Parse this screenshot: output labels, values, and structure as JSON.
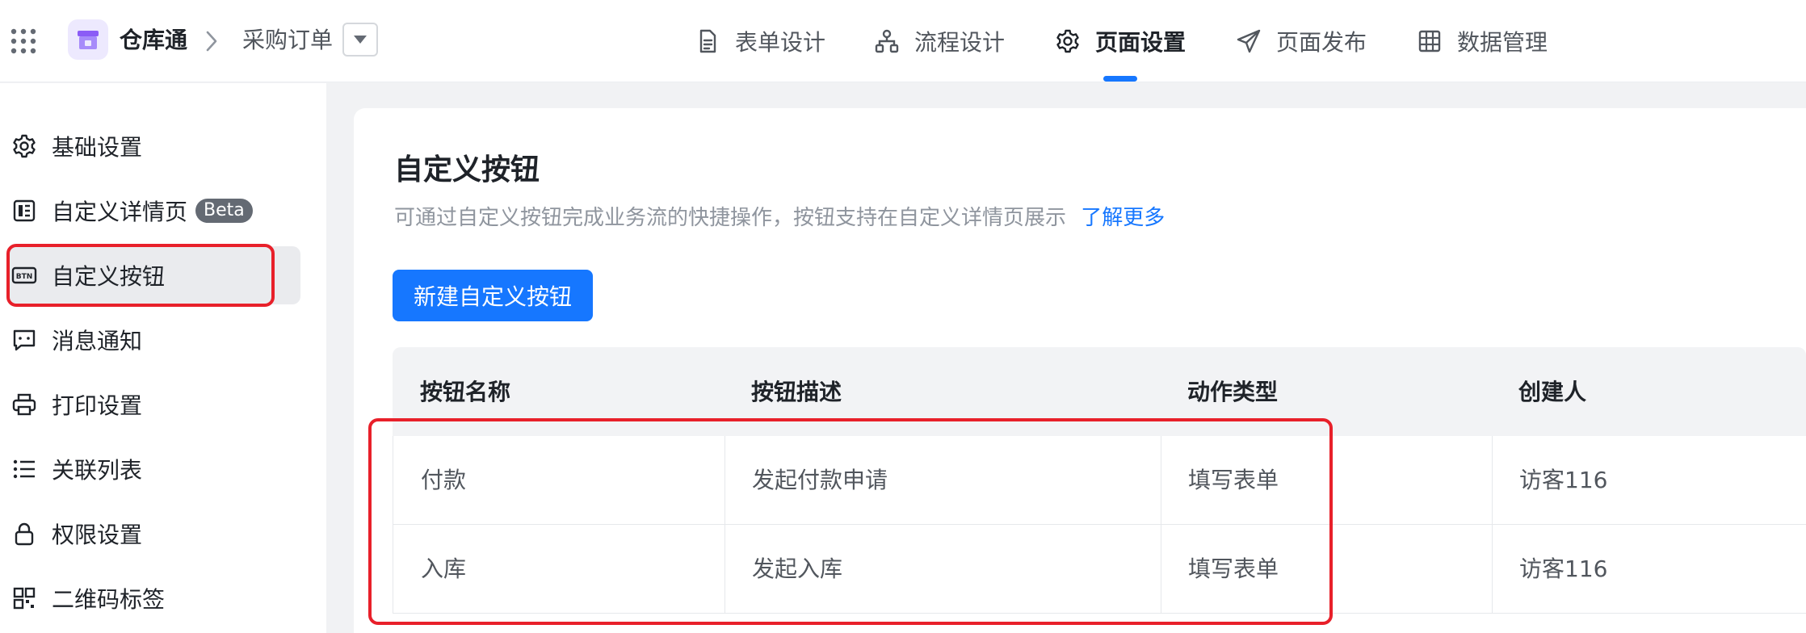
{
  "header": {
    "app_name": "仓库通",
    "current_page": "采购订单",
    "tabs": [
      {
        "label": "表单设计",
        "icon": "document-icon"
      },
      {
        "label": "流程设计",
        "icon": "flow-icon"
      },
      {
        "label": "页面设置",
        "icon": "gear-icon",
        "active": true
      },
      {
        "label": "页面发布",
        "icon": "send-icon"
      },
      {
        "label": "数据管理",
        "icon": "grid-icon"
      }
    ]
  },
  "sidebar": {
    "items": [
      {
        "label": "基础设置",
        "icon": "gear-icon"
      },
      {
        "label": "自定义详情页",
        "icon": "detail-page-icon",
        "badge": "Beta"
      },
      {
        "label": "自定义按钮",
        "icon": "btn-icon",
        "active": true
      },
      {
        "label": "消息通知",
        "icon": "message-icon"
      },
      {
        "label": "打印设置",
        "icon": "printer-icon"
      },
      {
        "label": "关联列表",
        "icon": "list-icon"
      },
      {
        "label": "权限设置",
        "icon": "lock-icon"
      },
      {
        "label": "二维码标签",
        "icon": "qrcode-icon"
      }
    ]
  },
  "main": {
    "title": "自定义按钮",
    "description": "可通过自定义按钮完成业务流的快捷操作，按钮支持在自定义详情页展示",
    "learn_more": "了解更多",
    "new_button_label": "新建自定义按钮",
    "table": {
      "columns": [
        "按钮名称",
        "按钮描述",
        "动作类型",
        "创建人"
      ],
      "rows": [
        [
          "付款",
          "发起付款申请",
          "填写表单",
          "访客116"
        ],
        [
          "入库",
          "发起入库",
          "填写表单",
          "访客116"
        ]
      ]
    }
  },
  "colors": {
    "accent": "#1677ff",
    "highlight": "#e8202a",
    "logo_purple": "#8b5cf6"
  }
}
